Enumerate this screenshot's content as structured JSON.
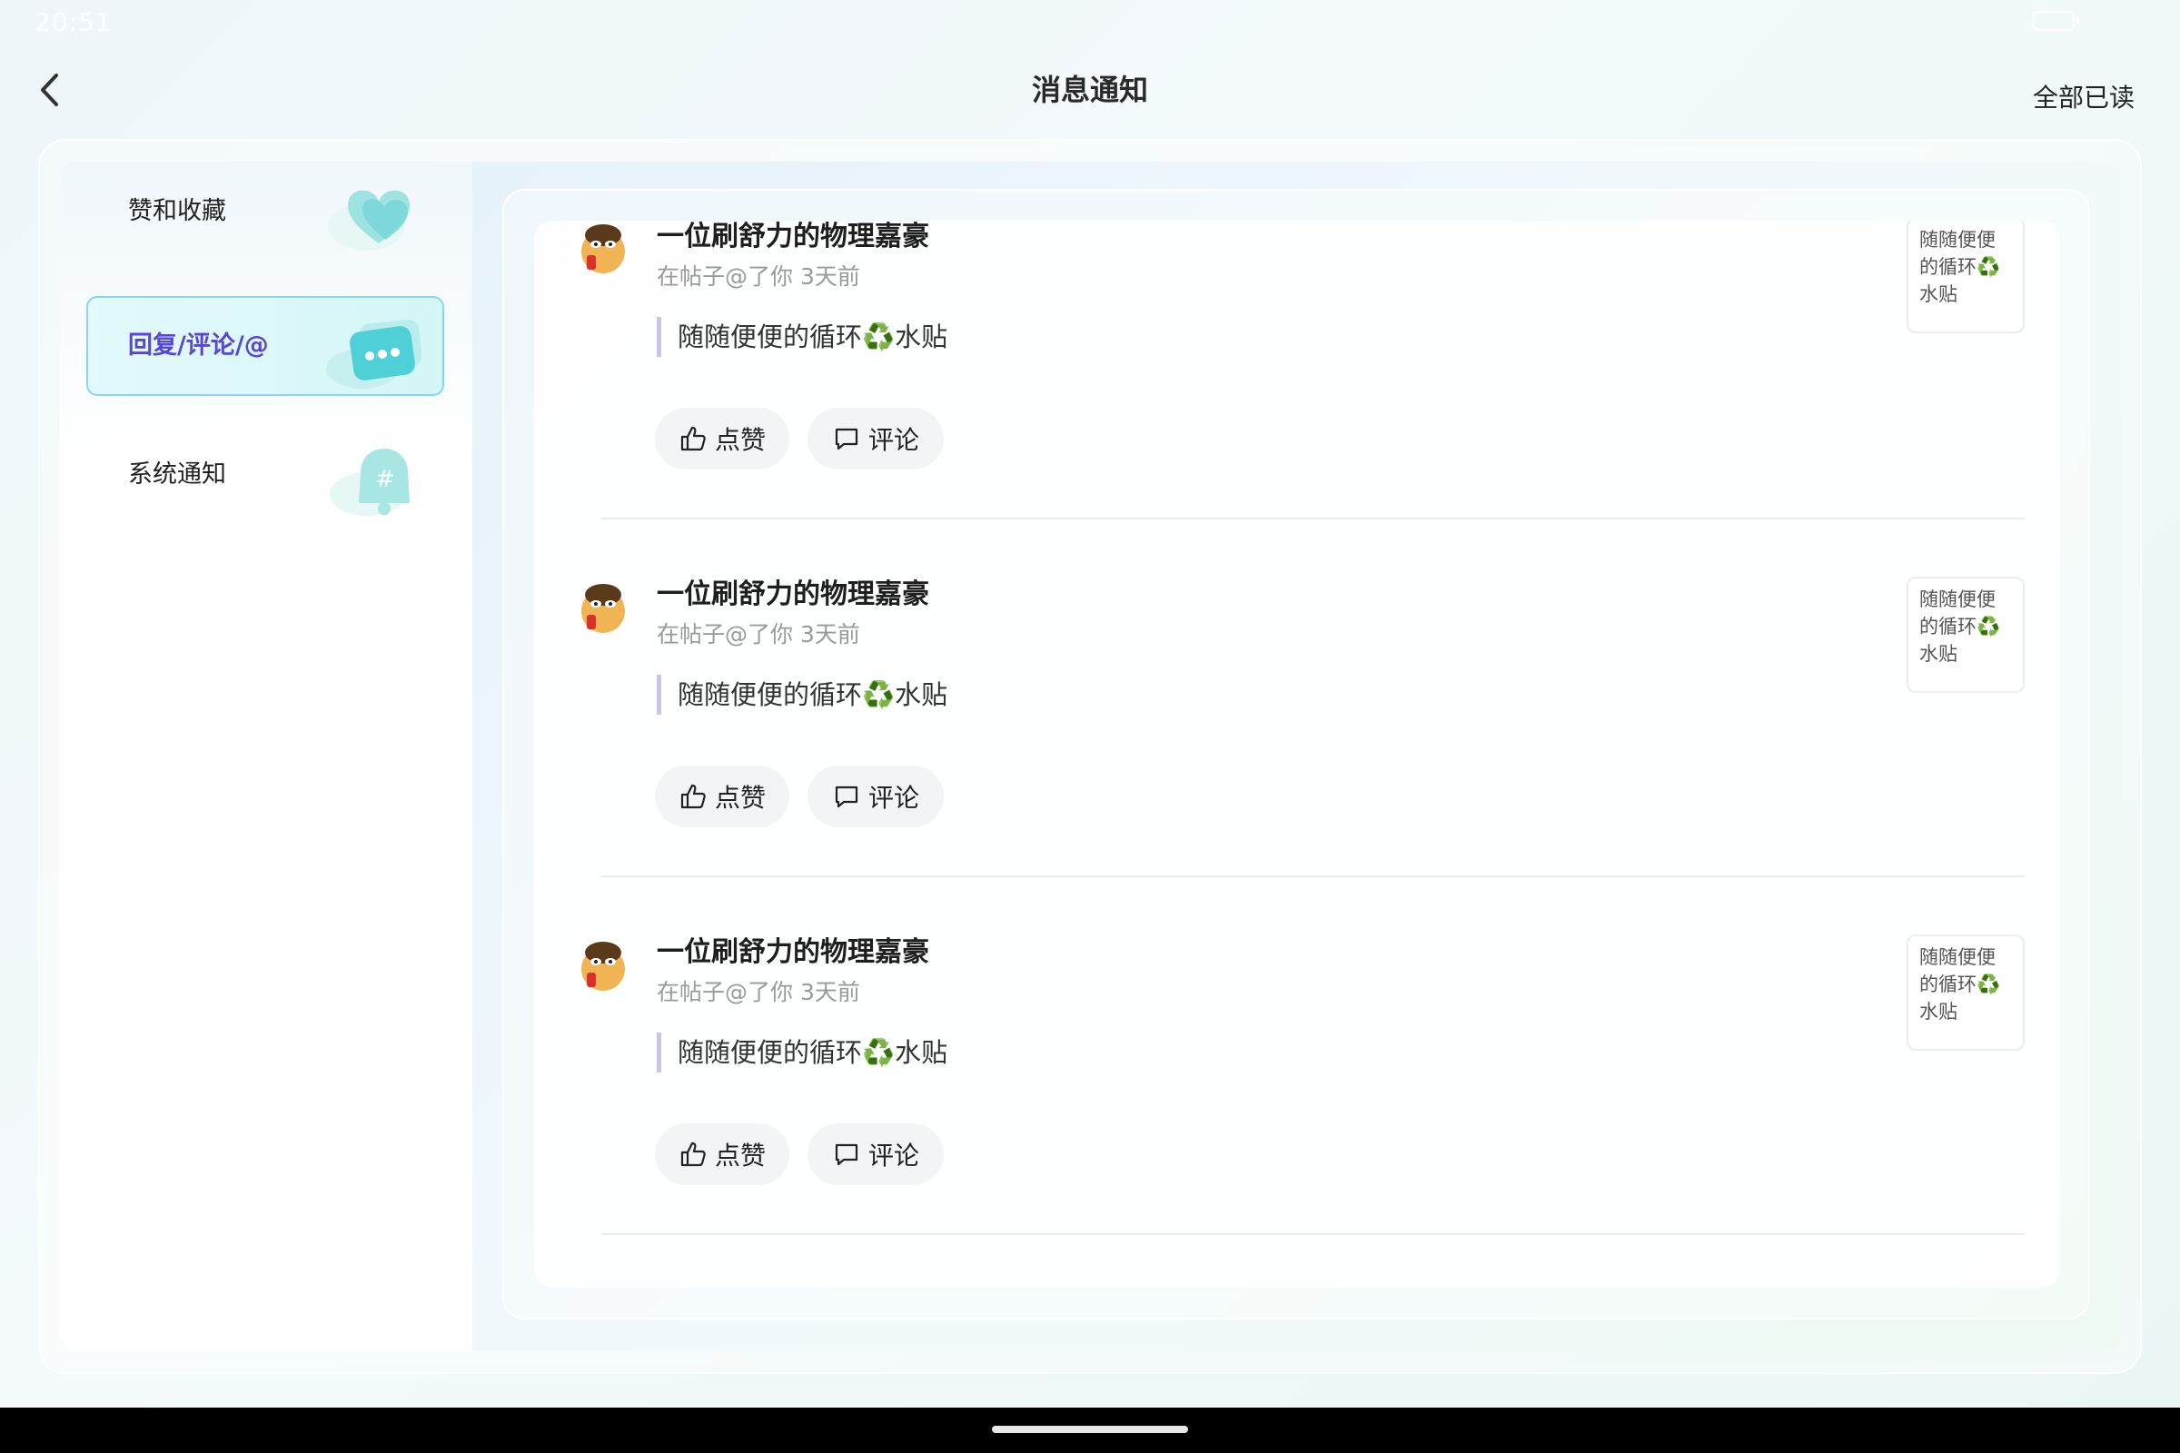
{
  "status_bar": {
    "time": "20:51"
  },
  "header": {
    "title": "消息通知",
    "mark_all_read": "全部已读"
  },
  "sidebar": {
    "items": [
      {
        "label": "赞和收藏",
        "icon": "heart-icon",
        "active": false
      },
      {
        "label": "回复/评论/@",
        "icon": "chat-bubble-icon",
        "active": true
      },
      {
        "label": "系统通知",
        "icon": "bell-icon",
        "active": false
      }
    ]
  },
  "messages": [
    {
      "username": "一位刷舒力的物理嘉豪",
      "meta": "在帖子@了你 3天前",
      "quote": "随随便便的循环♻️水贴",
      "like_label": "点赞",
      "comment_label": "评论",
      "thumbnail_text": "随随便便的循环♻️水贴"
    },
    {
      "username": "一位刷舒力的物理嘉豪",
      "meta": "在帖子@了你 3天前",
      "quote": "随随便便的循环♻️水贴",
      "like_label": "点赞",
      "comment_label": "评论",
      "thumbnail_text": "随随便便的循环♻️水贴"
    },
    {
      "username": "一位刷舒力的物理嘉豪",
      "meta": "在帖子@了你 3天前",
      "quote": "随随便便的循环♻️水贴",
      "like_label": "点赞",
      "comment_label": "评论",
      "thumbnail_text": "随随便便的循环♻️水贴"
    }
  ],
  "colors": {
    "accent": "#5a46d6",
    "active_border": "#86d8ee",
    "quote_bar": "#c9c3f2",
    "icon_teal": "#5fd3d8"
  }
}
